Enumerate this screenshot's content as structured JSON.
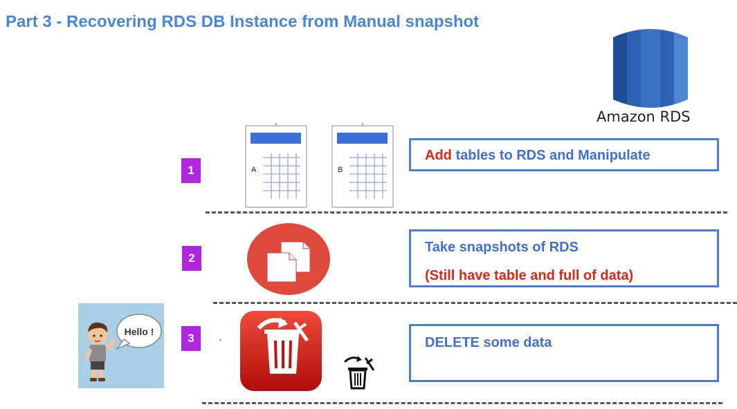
{
  "title": "Part 3 - Recovering RDS DB Instance from Manual snapshot",
  "logo": {
    "label": "Amazon RDS",
    "color": "#2e5aa6"
  },
  "steps": [
    {
      "number": "1",
      "sheets": [
        "A",
        "B"
      ],
      "text_prefix": "Add",
      "text_rest": " tables to RDS and Manipulate"
    },
    {
      "number": "2",
      "line1": "Take snapshots of RDS",
      "line2": "(Still have table and full of data)"
    },
    {
      "number": "3",
      "line1": "DELETE some data"
    }
  ],
  "character": {
    "speech": "Hello !"
  },
  "colors": {
    "title": "#4a86d8",
    "badge": "#b026e0",
    "box_border": "#4a7bd8",
    "red_text": "#e02416",
    "snapshot_circle": "#dd4a3c",
    "delete_tile": "#d01818"
  }
}
